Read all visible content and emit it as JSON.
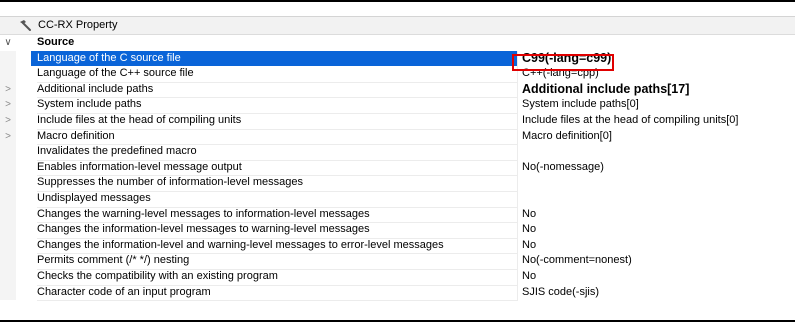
{
  "panel": {
    "title": "CC-RX Property"
  },
  "category": {
    "label": "Source"
  },
  "rows": [
    {
      "name": "Language of the C source file",
      "value": "C99(-lang=c99)",
      "expander": ""
    },
    {
      "name": "Language of the C++ source file",
      "value": "C++(-lang=cpp)",
      "expander": ""
    },
    {
      "name": "Additional include paths",
      "value": "Additional include paths[17]",
      "expander": ">"
    },
    {
      "name": "System include paths",
      "value": "System include paths[0]",
      "expander": ">"
    },
    {
      "name": "Include files at the head of compiling units",
      "value": "Include files at the head of compiling units[0]",
      "expander": ">"
    },
    {
      "name": "Macro definition",
      "value": "Macro definition[0]",
      "expander": ">"
    },
    {
      "name": "Invalidates the predefined macro",
      "value": "",
      "expander": ""
    },
    {
      "name": "Enables information-level message output",
      "value": "No(-nomessage)",
      "expander": ""
    },
    {
      "name": "Suppresses the number of information-level messages",
      "value": "",
      "expander": ""
    },
    {
      "name": "Undisplayed messages",
      "value": "",
      "expander": ""
    },
    {
      "name": "Changes the warning-level messages to information-level messages",
      "value": "No",
      "expander": ""
    },
    {
      "name": "Changes the information-level messages to warning-level messages",
      "value": "No",
      "expander": ""
    },
    {
      "name": "Changes the information-level and warning-level messages to error-level messages",
      "value": "No",
      "expander": ""
    },
    {
      "name": "Permits comment (/* */) nesting",
      "value": "No(-comment=nonest)",
      "expander": ""
    },
    {
      "name": "Checks the compatibility with an existing program",
      "value": "No",
      "expander": ""
    },
    {
      "name": "Character code of an input program",
      "value": "SJIS code(-sjis)",
      "expander": ""
    }
  ],
  "colors": {
    "selection": "#0a64d8",
    "highlight_box": "#e00000"
  },
  "icons": {
    "panel": "hammer-icon",
    "category": "chevron-down-icon",
    "row_expander": "chevron-right-icon"
  }
}
